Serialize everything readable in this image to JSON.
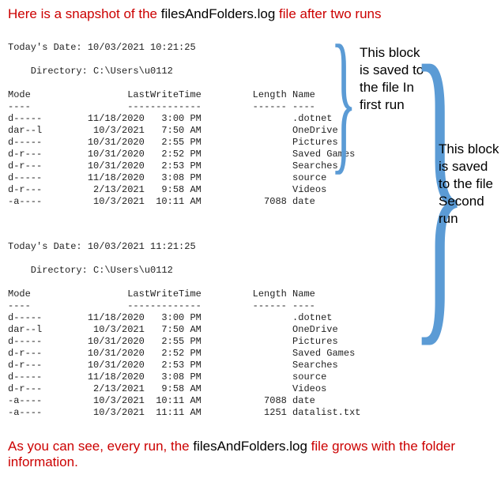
{
  "heading": {
    "t1": "Here is a snapshot of the ",
    "t2": "filesAndFolders.log",
    "t3": " file after two runs"
  },
  "log": {
    "block1": {
      "date": "Today's Date: 10/03/2021 10:21:25",
      "dir": "    Directory: C:\\Users\\u0112",
      "hdr": "Mode                 LastWriteTime         Length Name",
      "sep": "----                 -------------         ------ ----",
      "rows": [
        "d-----        11/18/2020   3:00 PM                .dotnet",
        "dar--l         10/3/2021   7:50 AM                OneDrive",
        "d-----        10/31/2020   2:55 PM                Pictures",
        "d-r---        10/31/2020   2:52 PM                Saved Games",
        "d-r---        10/31/2020   2:53 PM                Searches",
        "d-----        11/18/2020   3:08 PM                source",
        "d-r---         2/13/2021   9:58 AM                Videos",
        "-a----         10/3/2021  10:11 AM           7088 date"
      ]
    },
    "block2": {
      "date": "Today's Date: 10/03/2021 11:21:25",
      "dir": "    Directory: C:\\Users\\u0112",
      "hdr": "Mode                 LastWriteTime         Length Name",
      "sep": "----                 -------------         ------ ----",
      "rows": [
        "d-----        11/18/2020   3:00 PM                .dotnet",
        "dar--l         10/3/2021   7:50 AM                OneDrive",
        "d-----        10/31/2020   2:55 PM                Pictures",
        "d-r---        10/31/2020   2:52 PM                Saved Games",
        "d-r---        10/31/2020   2:53 PM                Searches",
        "d-----        11/18/2020   3:08 PM                source",
        "d-r---         2/13/2021   9:58 AM                Videos",
        "-a----         10/3/2021  10:11 AM           7088 date",
        "-a----         10/3/2021  11:11 AM           1251 datalist.txt"
      ]
    }
  },
  "annot": {
    "first": "This block is saved to the file In first run",
    "second": "This block is saved to the file Second run"
  },
  "footer": {
    "t1": "As you can see, every run, the ",
    "t2": "filesAndFolders.log",
    "t3": " file grows with the folder information."
  }
}
